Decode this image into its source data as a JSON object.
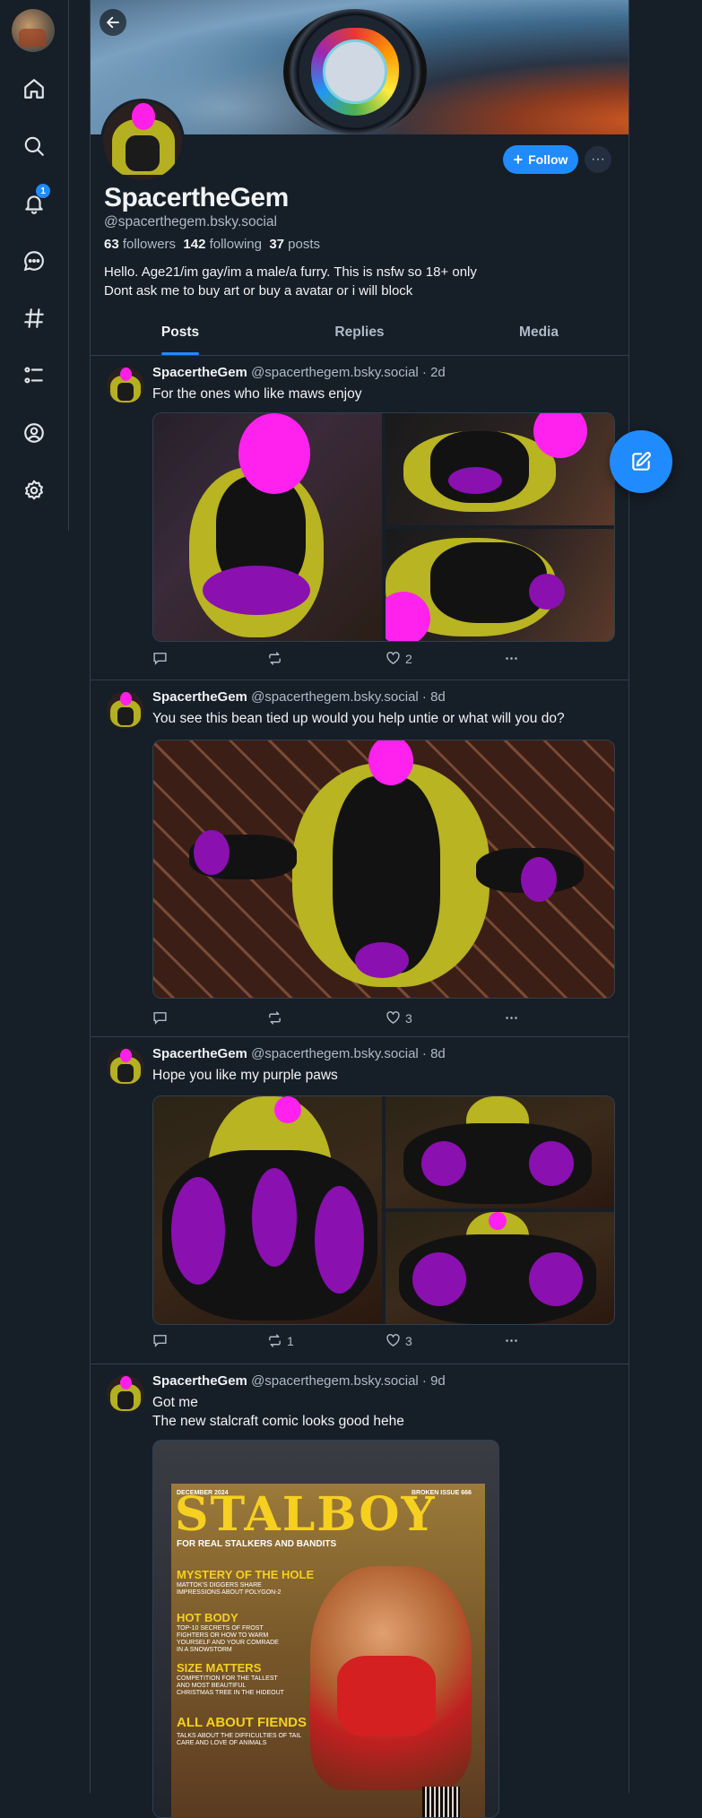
{
  "sidebar": {
    "notifications_badge": "1",
    "items": [
      {
        "name": "home",
        "icon": "home-icon"
      },
      {
        "name": "search",
        "icon": "search-icon"
      },
      {
        "name": "notifications",
        "icon": "bell-icon"
      },
      {
        "name": "chat",
        "icon": "chat-bubble-icon"
      },
      {
        "name": "feeds",
        "icon": "hashtag-icon"
      },
      {
        "name": "lists",
        "icon": "list-icon"
      },
      {
        "name": "profile",
        "icon": "user-circle-icon"
      },
      {
        "name": "settings",
        "icon": "gear-icon"
      }
    ]
  },
  "profile": {
    "display_name": "SpacertheGem",
    "handle": "@spacerthegem.bsky.social",
    "followers_count": "63",
    "followers_label": "followers",
    "following_count": "142",
    "following_label": "following",
    "posts_count": "37",
    "posts_label": "posts",
    "bio_line1": "Hello. Age21/im gay/im a male/a furry. This is nsfw so 18+ only",
    "bio_line2": "Dont ask me to buy art or buy a avatar or i will block",
    "follow_label": "Follow",
    "more_label": "···"
  },
  "tabs": [
    {
      "label": "Posts",
      "active": true
    },
    {
      "label": "Replies",
      "active": false
    },
    {
      "label": "Media",
      "active": false
    }
  ],
  "posts": [
    {
      "author": "SpacertheGem",
      "meta": "@spacerthegem.bsky.social · 2d",
      "text": "For the ones who like maws enjoy",
      "replies": "",
      "reposts": "",
      "likes": "2"
    },
    {
      "author": "SpacertheGem",
      "meta": "@spacerthegem.bsky.social · 8d",
      "text": "You see this bean tied up would you help untie or what will you do?",
      "replies": "",
      "reposts": "",
      "likes": "3"
    },
    {
      "author": "SpacertheGem",
      "meta": "@spacerthegem.bsky.social · 8d",
      "text": "Hope you like my purple paws",
      "replies": "",
      "reposts": "1",
      "likes": "3"
    },
    {
      "author": "SpacertheGem",
      "meta": "@spacerthegem.bsky.social · 9d",
      "text_line1": "Got me",
      "text_line2": "The new stalcraft comic looks good hehe"
    }
  ],
  "poster": {
    "title": "STALBOY",
    "date": "DECEMBER 2024",
    "issue": "BROKEN ISSUE 666",
    "tagline": "FOR REAL STALKERS AND BANDITS",
    "h1": "MYSTERY OF THE HOLE",
    "s1": "MATTOK'S DIGGERS SHARE IMPRESSIONS ABOUT POLYGON-2",
    "h2": "HOT BODY",
    "s2": "TOP-10 SECRETS OF FROST FIGHTERS OR HOW TO WARM YOURSELF AND YOUR COMRADE IN A SNOWSTORM",
    "h3": "SIZE MATTERS",
    "s3": "COMPETITION FOR THE TALLEST AND MOST BEAUTIFUL CHRISTMAS TREE IN THE HIDEOUT",
    "h4": "ALL ABOUT FIENDS",
    "s4": "TALKS ABOUT THE DIFFICULTIES OF TAIL CARE AND LOVE OF ANIMALS"
  },
  "colors": {
    "accent": "#208bfe",
    "background": "#161e27",
    "border": "#2e4052",
    "muted_text": "#aebbc9"
  }
}
